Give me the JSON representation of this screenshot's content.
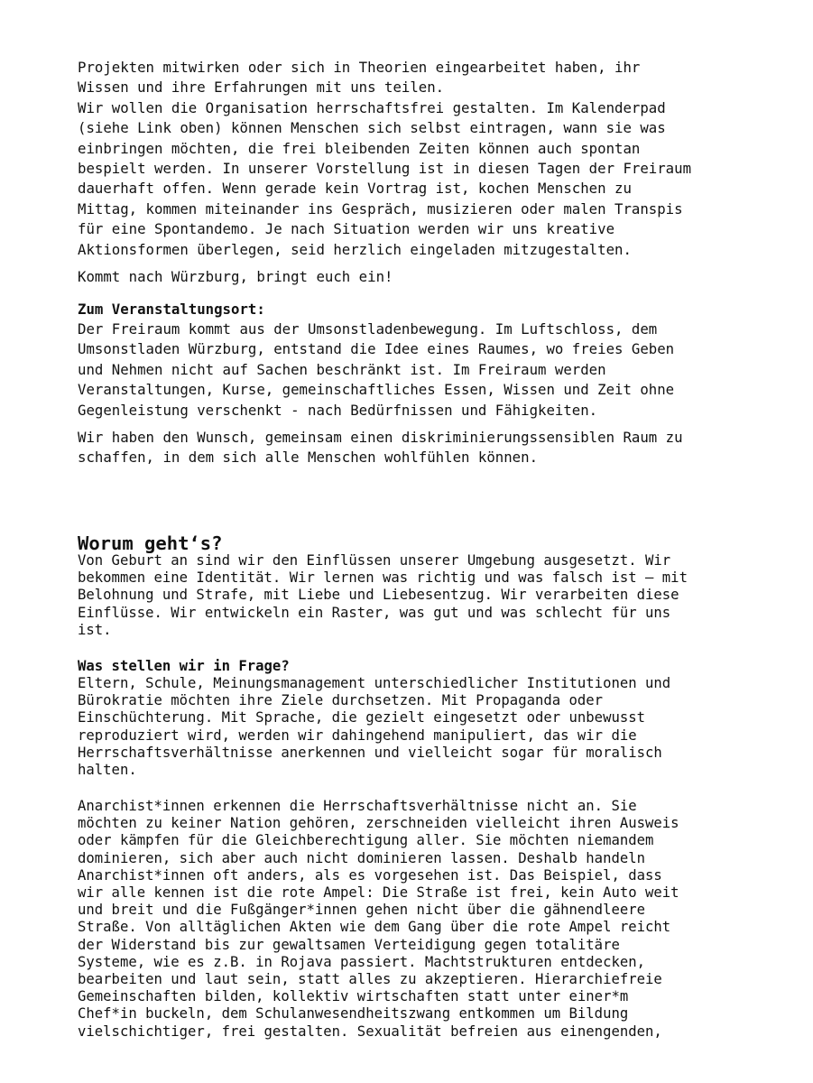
{
  "section1": {
    "intro_paragraph": "Projekten mitwirken oder sich in Theorien eingearbeitet haben, ihr\nWissen und ihre Erfahrungen mit uns teilen.\nWir wollen die Organisation herrschaftsfrei gestalten. Im Kalenderpad\n(siehe Link oben) können Menschen sich selbst eintragen, wann sie was\neinbringen möchten, die frei bleibenden Zeiten können auch spontan\nbespielt werden. In unserer Vorstellung ist in diesen Tagen der Freiraum\ndauerhaft offen. Wenn gerade kein Vortrag ist, kochen Menschen zu\nMittag, kommen miteinander ins Gespräch, musizieren oder malen Transpis\nfür eine Spontandemo. Je nach Situation werden wir uns kreative\nAktionsformen überlegen, seid herzlich eingeladen mitzugestalten.",
    "call_to_action": "Kommt nach Würzburg, bringt euch ein!",
    "venue_heading": "Zum Veranstaltungsort:",
    "venue_paragraph": "Der Freiraum kommt aus der Umsonstladenbewegung. Im Luftschloss, dem\nUmsonstladen Würzburg, entstand die Idee eines Raumes, wo freies Geben\nund Nehmen nicht auf Sachen beschränkt ist. Im Freiraum werden\nVeranstaltungen, Kurse, gemeinschaftliches Essen, Wissen und Zeit ohne\nGegenleistung verschenkt - nach Bedürfnissen und Fähigkeiten.",
    "wish_paragraph": "Wir haben den Wunsch, gemeinsam einen diskriminierungssensiblen Raum zu\nschaffen, in dem sich alle Menschen wohlfühlen können."
  },
  "section2": {
    "heading": "Worum geht‘s?",
    "intro_paragraph": "Von Geburt an sind wir den Einflüssen unserer Umgebung ausgesetzt. Wir\nbekommen eine Identität. Wir lernen was richtig und was falsch ist – mit\nBelohnung und Strafe, mit Liebe und Liebesentzug. Wir verarbeiten diese\nEinflüsse. Wir entwickeln ein Raster, was gut und was schlecht für uns\nist.",
    "question_heading": "Was stellen wir in Frage?",
    "question_paragraph": "Eltern, Schule, Meinungsmanagement unterschiedlicher Institutionen und\nBürokratie möchten ihre Ziele durchsetzen. Mit Propaganda oder\nEinschüchterung. Mit Sprache, die gezielt eingesetzt oder unbewusst\nreproduziert wird, werden wir dahingehend manipuliert, das wir die\nHerrschaftsverhältnisse anerkennen und vielleicht sogar für moralisch\nhalten.",
    "anarchist_paragraph": "Anarchist*innen erkennen die Herrschaftsverhältnisse nicht an. Sie\nmöchten zu keiner Nation gehören, zerschneiden vielleicht ihren Ausweis\noder kämpfen für die Gleichberechtigung aller. Sie möchten niemandem\ndominieren, sich aber auch nicht dominieren lassen. Deshalb handeln\nAnarchist*innen oft anders, als es vorgesehen ist. Das Beispiel, dass\nwir alle kennen ist die rote Ampel: Die Straße ist frei, kein Auto weit\nund breit und die Fußgänger*innen gehen nicht über die gähnendleere\nStraße. Von alltäglichen Akten wie dem Gang über die rote Ampel reicht\nder Widerstand bis zur gewaltsamen Verteidigung gegen totalitäre\nSysteme, wie es z.B. in Rojava passiert. Machtstrukturen entdecken,\nbearbeiten und laut sein, statt alles zu akzeptieren. Hierarchiefreie\nGemeinschaften bilden, kollektiv wirtschaften statt unter einer*m\nChef*in buckeln, dem Schulanwesendheitszwang entkommen um Bildung\nvielschichtiger, frei gestalten. Sexualität befreien aus einengenden,"
  }
}
